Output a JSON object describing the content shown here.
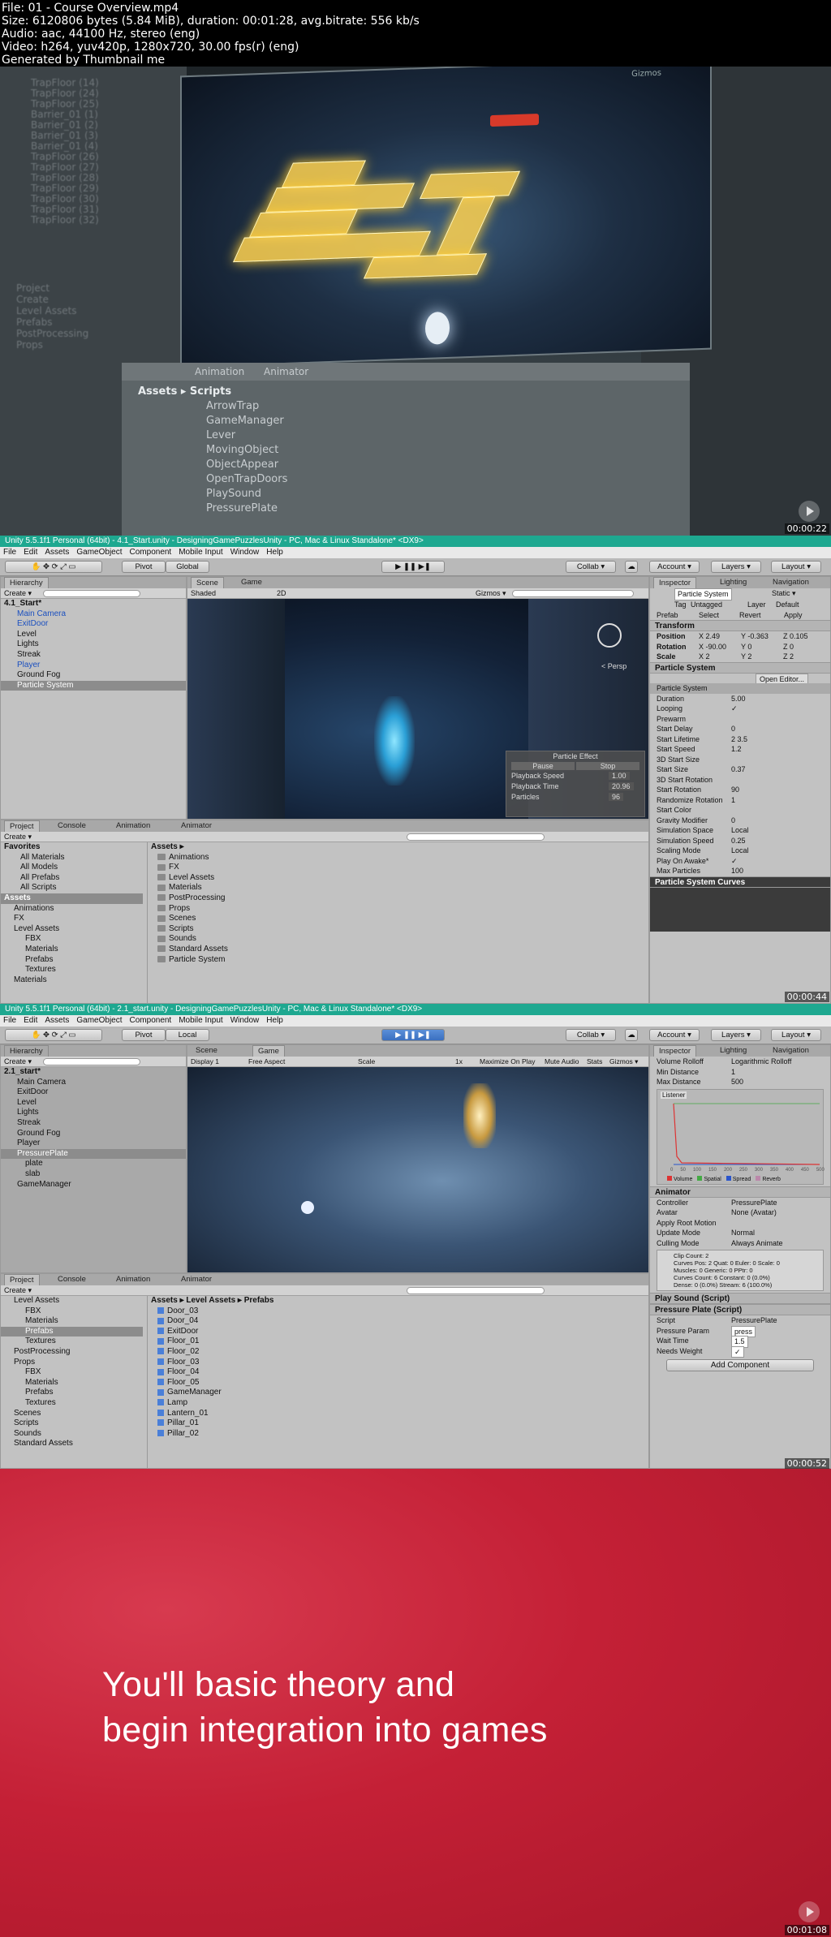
{
  "meta": {
    "line1": "File: 01 - Course Overview.mp4",
    "line2": "Size: 6120806 bytes (5.84 MiB), duration: 00:01:28, avg.bitrate: 556 kb/s",
    "line3": "Audio: aac, 44100 Hz, stereo (eng)",
    "line4": "Video: h264, yuv420p, 1280x720, 30.00 fps(r) (eng)",
    "line5": "Generated by Thumbnail me"
  },
  "frame1": {
    "timestamp": "00:00:22",
    "bottom_tabs": [
      "Animation",
      "Animator"
    ],
    "breadcrumb_root": "Assets",
    "breadcrumb_sep": "▸",
    "breadcrumb_folder": "Scripts",
    "scripts": [
      "ArrowTrap",
      "GameManager",
      "Lever",
      "MovingObject",
      "ObjectAppear",
      "OpenTrapDoors",
      "PlaySound",
      "PressurePlate"
    ],
    "left_items": [
      "TrapFloor (14)",
      "TrapFloor (24)",
      "TrapFloor (25)",
      "Barrier_01 (1)",
      "Barrier_01 (2)",
      "Barrier_01 (3)",
      "Barrier_01 (4)",
      "TrapFloor (26)",
      "TrapFloor (27)",
      "TrapFloor (28)",
      "TrapFloor (29)",
      "TrapFloor (30)",
      "TrapFloor (31)",
      "TrapFloor (32)"
    ],
    "left_bottom": [
      "Project",
      "Create",
      "Level Assets",
      "Prefabs",
      "PostProcessing",
      "Props"
    ],
    "gizmos": "Gizmos"
  },
  "frame2": {
    "timestamp": "00:00:44",
    "title": "Unity 5.5.1f1 Personal (64bit) - 4.1_Start.unity - DesigningGamePuzzlesUnity - PC, Mac & Linux Standalone* <DX9>",
    "menu": [
      "File",
      "Edit",
      "Assets",
      "GameObject",
      "Component",
      "Mobile Input",
      "Window",
      "Help"
    ],
    "toolbar": {
      "pivot": "Pivot",
      "global": "Global",
      "collab": "Collab ▾",
      "account": "Account ▾",
      "layers": "Layers ▾",
      "layout": "Layout ▾"
    },
    "hierarchy_tab": "Hierarchy",
    "create": "Create ▾",
    "search_hint": "All",
    "hierarchy": [
      "4.1_Start*",
      "Main Camera",
      "ExitDoor",
      "Level",
      "Lights",
      "Streak",
      "Player",
      "Ground Fog",
      "Particle System"
    ],
    "scene_tabs": [
      "Scene",
      "Game"
    ],
    "scene_bar": {
      "shaded": "Shaded",
      "mode2d": "2D",
      "gizmos": "Gizmos ▾",
      "search": "All"
    },
    "persp": "< Persp",
    "particle_effect": {
      "title": "Particle Effect",
      "pause": "Pause",
      "stop": "Stop",
      "rows": [
        [
          "Playback Speed",
          "1.00"
        ],
        [
          "Playback Time",
          "20.96"
        ],
        [
          "Particles",
          "96"
        ]
      ]
    },
    "inspector_tabs": [
      "Inspector",
      "Lighting",
      "Navigation"
    ],
    "object_name": "Particle System",
    "static": "Static ▾",
    "tag_label": "Tag",
    "tag": "Untagged",
    "layer_label": "Layer",
    "layer": "Default",
    "prefab_label": "Prefab",
    "prefab_btns": [
      "Select",
      "Revert",
      "Apply"
    ],
    "transform_title": "Transform",
    "transform": [
      [
        "Position",
        "X 2.49",
        "Y -0.363",
        "Z 0.105"
      ],
      [
        "Rotation",
        "X -90.00",
        "Y 0",
        "Z 0"
      ],
      [
        "Scale",
        "X 2",
        "Y 2",
        "Z 2"
      ]
    ],
    "ps_title": "Particle System",
    "open_editor": "Open Editor...",
    "ps_sub": "Particle System",
    "ps_rows": [
      [
        "Duration",
        "5.00"
      ],
      [
        "Looping",
        "✓"
      ],
      [
        "Prewarm",
        ""
      ],
      [
        "Start Delay",
        "0"
      ],
      [
        "Start Lifetime",
        "2          3.5"
      ],
      [
        "Start Speed",
        "1.2"
      ],
      [
        "3D Start Size",
        ""
      ],
      [
        "Start Size",
        "0.37"
      ],
      [
        "3D Start Rotation",
        ""
      ],
      [
        "Start Rotation",
        "90"
      ],
      [
        "Randomize Rotation",
        "1"
      ],
      [
        "Start Color",
        ""
      ],
      [
        "Gravity Modifier",
        "0"
      ],
      [
        "Simulation Space",
        "Local"
      ],
      [
        "Simulation Speed",
        "0.25"
      ],
      [
        "Scaling Mode",
        "Local"
      ],
      [
        "Play On Awake*",
        "✓"
      ],
      [
        "Max Particles",
        "100"
      ]
    ],
    "curves_title": "Particle System Curves",
    "project_tabs": [
      "Project",
      "Console",
      "Animation",
      "Animator"
    ],
    "favorites": [
      "Favorites",
      "All Materials",
      "All Models",
      "All Prefabs",
      "All Scripts"
    ],
    "assets_tree": [
      "Assets",
      "Animations",
      "FX",
      "Level Assets",
      "FBX",
      "Materials",
      "Prefabs",
      "Textures",
      "Materials"
    ],
    "assets_header": "Assets ▸",
    "assets_list": [
      "Animations",
      "FX",
      "Level Assets",
      "Materials",
      "PostProcessing",
      "Props",
      "Scenes",
      "Scripts",
      "Sounds",
      "Standard Assets",
      "Particle System"
    ]
  },
  "frame3": {
    "timestamp": "00:00:52",
    "title": "Unity 5.5.1f1 Personal (64bit) - 2.1_start.unity - DesigningGamePuzzlesUnity - PC, Mac & Linux Standalone* <DX9>",
    "menu": [
      "File",
      "Edit",
      "Assets",
      "GameObject",
      "Component",
      "Mobile Input",
      "Window",
      "Help"
    ],
    "toolbar": {
      "pivot": "Pivot",
      "local": "Local",
      "collab": "Collab ▾",
      "account": "Account ▾",
      "layers": "Layers ▾",
      "layout": "Layout ▾"
    },
    "hierarchy_tab": "Hierarchy",
    "create": "Create ▾",
    "search_hint": "All",
    "hierarchy": [
      "2.1_start*",
      "Main Camera",
      "ExitDoor",
      "Level",
      "Lights",
      "Streak",
      "Ground Fog",
      "Player",
      "PressurePlate",
      "plate",
      "slab",
      "GameManager"
    ],
    "scene_tabs": [
      "Scene",
      "Game"
    ],
    "game_bar": {
      "display": "Display 1",
      "aspect": "Free Aspect",
      "scale": "Scale",
      "scale_val": "1x",
      "maximize": "Maximize On Play",
      "mute": "Mute Audio",
      "stats": "Stats",
      "gizmos": "Gizmos ▾"
    },
    "inspector_tabs": [
      "Inspector",
      "Lighting",
      "Navigation"
    ],
    "audio_rows": [
      [
        "Volume Rolloff",
        "Logarithmic Rolloff"
      ],
      [
        "Min Distance",
        "1"
      ],
      [
        "Max Distance",
        "500"
      ]
    ],
    "listener": "Listener",
    "curve_legend": [
      "Volume",
      "Spatial",
      "Spread",
      "Reverb"
    ],
    "curve_ticks": [
      "0",
      "50",
      "100",
      "150",
      "200",
      "250",
      "300",
      "350",
      "400",
      "450",
      "500"
    ],
    "animator_title": "Animator",
    "animator_rows": [
      [
        "Controller",
        "PressurePlate"
      ],
      [
        "Avatar",
        "None (Avatar)"
      ],
      [
        "Apply Root Motion",
        ""
      ],
      [
        "Update Mode",
        "Normal"
      ],
      [
        "Culling Mode",
        "Always Animate"
      ]
    ],
    "info": [
      "Clip Count: 2",
      "Curves Pos: 2 Quat: 0 Euler: 0 Scale: 0",
      "Muscles: 0 Generic: 0 PPtr: 0",
      "Curves Count: 6 Constant: 0 (0.0%)",
      "Dense: 0 (0.0%) Stream: 6 (100.0%)"
    ],
    "play_sound": "Play Sound (Script)",
    "pressure_plate": "Pressure Plate (Script)",
    "script_label": "Script",
    "script_val": "PressurePlate",
    "pp_rows": [
      [
        "Pressure Param",
        "press"
      ],
      [
        "Wait Time",
        "1.5"
      ],
      [
        "Needs Weight",
        "✓"
      ]
    ],
    "add_component": "Add Component",
    "project_tabs": [
      "Project",
      "Console",
      "Animation",
      "Animator"
    ],
    "tree": [
      "Level Assets",
      "FBX",
      "Materials",
      "Prefabs",
      "Textures",
      "PostProcessing",
      "Props",
      "FBX",
      "Materials",
      "Prefabs",
      "Textures",
      "Scenes",
      "Scripts",
      "Sounds",
      "Standard Assets"
    ],
    "breadcrumb": "Assets ▸ Level Assets ▸ Prefabs",
    "prefabs": [
      "Door_03",
      "Door_04",
      "ExitDoor",
      "Floor_01",
      "Floor_02",
      "Floor_03",
      "Floor_04",
      "Floor_05",
      "GameManager",
      "Lamp",
      "Lantern_01",
      "Pillar_01",
      "Pillar_02"
    ]
  },
  "frame4": {
    "timestamp": "00:01:08",
    "line1": "You'll basic theory and",
    "line2": "begin integration into games"
  },
  "colors": {
    "title_bar": "#1ea890",
    "red_bg": "#c42036",
    "unity_grey": "#c2c2c2"
  }
}
